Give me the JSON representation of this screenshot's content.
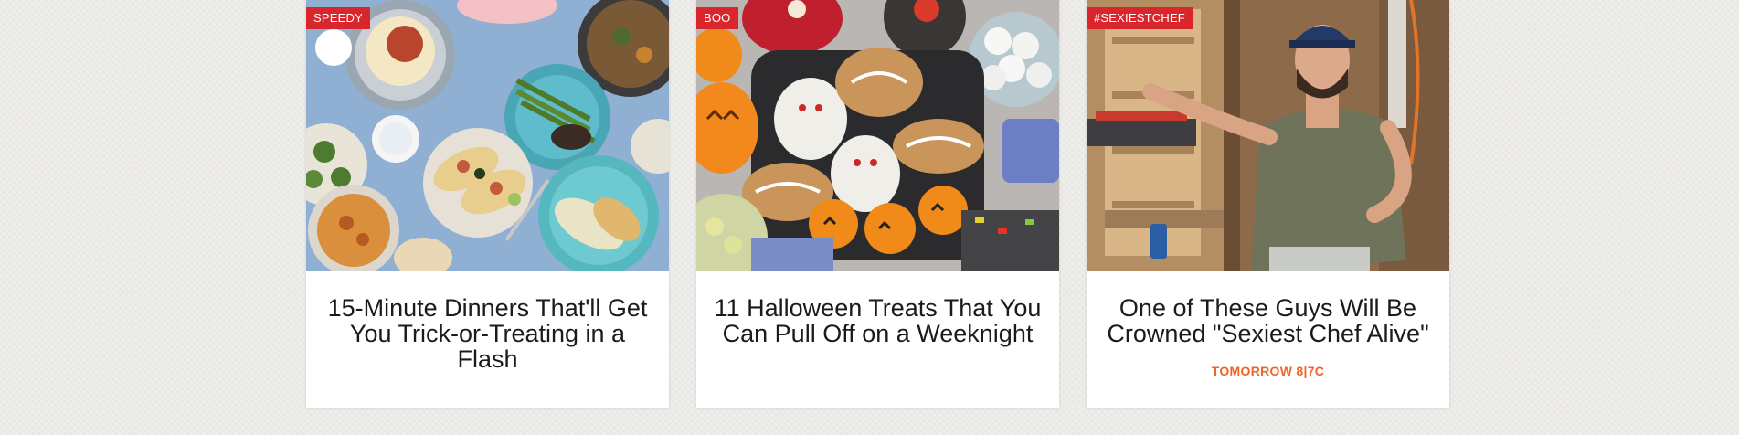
{
  "cards": [
    {
      "tag": "SPEEDY",
      "title": "15-Minute Dinners That'll Get You Trick-or-Treating in a Flash",
      "meta": "",
      "image_subject": "overhead view of assorted quick dinner plates"
    },
    {
      "tag": "BOO",
      "title": "11 Halloween Treats That You Can Pull Off on a Weeknight",
      "meta": "",
      "image_subject": "halloween cookies, mummy treats and jack-o'-lanterns"
    },
    {
      "tag": "#SEXIESTCHEF",
      "title": "One of These Guys Will Be Crowned \"Sexiest Chef Alive\"",
      "meta": "TOMORROW 8|7C",
      "image_subject": "bearded man in green t-shirt in a workshop"
    }
  ],
  "colors": {
    "tag_bg": "#d8262c",
    "meta_accent": "#f0642a",
    "page_bg": "#efeeeb"
  }
}
